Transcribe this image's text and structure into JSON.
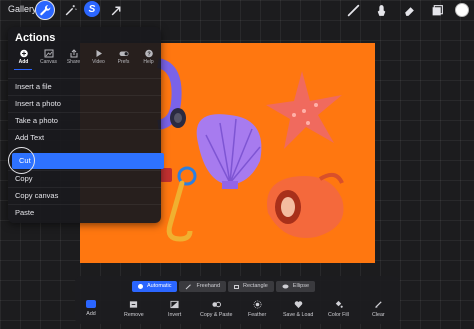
{
  "topbar": {
    "gallery_label": "Gallery",
    "icons": [
      "wrench-icon",
      "magic-wand-icon",
      "selection-s-icon",
      "transform-arrow-icon",
      "brush-icon",
      "smudge-icon",
      "eraser-icon",
      "layers-icon",
      "color-swatch"
    ],
    "selection_letter": "S"
  },
  "actions": {
    "title": "Actions",
    "tabs": [
      {
        "label": "Add",
        "icon": "add-icon",
        "active": true
      },
      {
        "label": "Canvas",
        "icon": "canvas-icon",
        "active": false
      },
      {
        "label": "Share",
        "icon": "share-icon",
        "active": false
      },
      {
        "label": "Video",
        "icon": "video-icon",
        "active": false
      },
      {
        "label": "Prefs",
        "icon": "toggle-icon",
        "active": false
      },
      {
        "label": "Help",
        "icon": "help-icon",
        "active": false
      }
    ],
    "items": [
      {
        "label": "Insert a file",
        "highlight": false
      },
      {
        "label": "Insert a photo",
        "highlight": false
      },
      {
        "label": "Take a photo",
        "highlight": false
      },
      {
        "label": "Add Text",
        "highlight": false
      },
      {
        "label": "Cut",
        "highlight": true
      },
      {
        "label": "Copy",
        "highlight": false
      },
      {
        "label": "Copy canvas",
        "highlight": false
      },
      {
        "label": "Paste",
        "highlight": false
      }
    ]
  },
  "selection": {
    "modes": [
      {
        "label": "Automatic",
        "active": true
      },
      {
        "label": "Freehand",
        "active": false
      },
      {
        "label": "Rectangle",
        "active": false
      },
      {
        "label": "Ellipse",
        "active": false
      }
    ],
    "tools": [
      {
        "label": "Add",
        "icon": "add-icon"
      },
      {
        "label": "Remove",
        "icon": "remove-icon"
      },
      {
        "label": "Invert",
        "icon": "invert-icon"
      },
      {
        "label": "Copy & Paste",
        "icon": "copy-paste-icon"
      },
      {
        "label": "Feather",
        "icon": "feather-icon"
      },
      {
        "label": "Save & Load",
        "icon": "heart-icon"
      },
      {
        "label": "Color Fill",
        "icon": "color-fill-icon"
      },
      {
        "label": "Clear",
        "icon": "clear-icon"
      }
    ]
  },
  "colors": {
    "accent": "#2b66ff",
    "canvas_background": "#ff7710",
    "highlight": "#2e72ff",
    "current_color": "#ffffff"
  }
}
